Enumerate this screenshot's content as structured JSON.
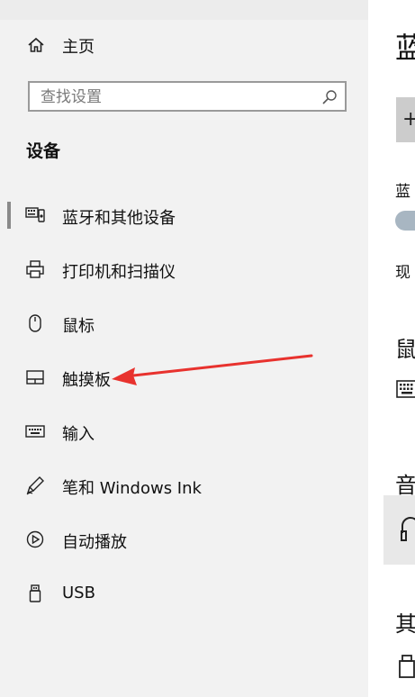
{
  "sidebar": {
    "home_label": "主页",
    "search": {
      "placeholder": "查找设置",
      "value": ""
    },
    "section_title": "设备",
    "items": [
      {
        "label": "蓝牙和其他设备",
        "icon": "bluetooth-devices-icon",
        "selected": true
      },
      {
        "label": "打印机和扫描仪",
        "icon": "printer-icon"
      },
      {
        "label": "鼠标",
        "icon": "mouse-icon"
      },
      {
        "label": "触摸板",
        "icon": "touchpad-icon"
      },
      {
        "label": "输入",
        "icon": "keyboard-icon"
      },
      {
        "label": "笔和 Windows Ink",
        "icon": "pen-icon"
      },
      {
        "label": "自动播放",
        "icon": "autoplay-icon"
      },
      {
        "label": "USB",
        "icon": "usb-icon"
      }
    ]
  },
  "main": {
    "heading": "蓝",
    "add_button_symbol": "+",
    "bluetooth_label": "蓝",
    "now_label": "现",
    "section_mouse": "鼠",
    "section_audio": "音",
    "section_other": "其"
  },
  "annotation": {
    "arrow_color": "#e8322e"
  },
  "colors": {
    "sidebar_bg": "#f2f2f2",
    "text": "#111111",
    "accent_toggle": "#a8b6c2"
  }
}
